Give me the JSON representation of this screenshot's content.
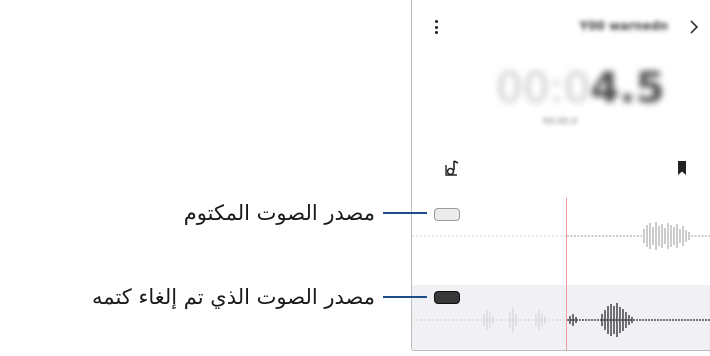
{
  "header": {
    "file_name": "Y00 warnedn",
    "next_icon": "chevron-right-icon",
    "menu_icon": "more-vertical-icon"
  },
  "timer": {
    "dim": "00:0",
    "main": "4.5",
    "sub": "00:00.0"
  },
  "controls": {
    "left_icon": "playlist-music-icon",
    "right_icon": "bookmark-icon"
  },
  "tracks": [
    {
      "state": "muted",
      "button_color": "#ebebeb"
    },
    {
      "state": "unmuted",
      "button_color": "#383838"
    }
  ],
  "callouts": {
    "muted_source": "مصدر الصوت المكتوم",
    "unmuted_source": "مصدر الصوت الذي تم إلغاء كتمه"
  },
  "colors": {
    "callout_line": "#1e4d86",
    "playhead": "#ef9aa3",
    "active_track_bg": "#f1f1f5"
  }
}
